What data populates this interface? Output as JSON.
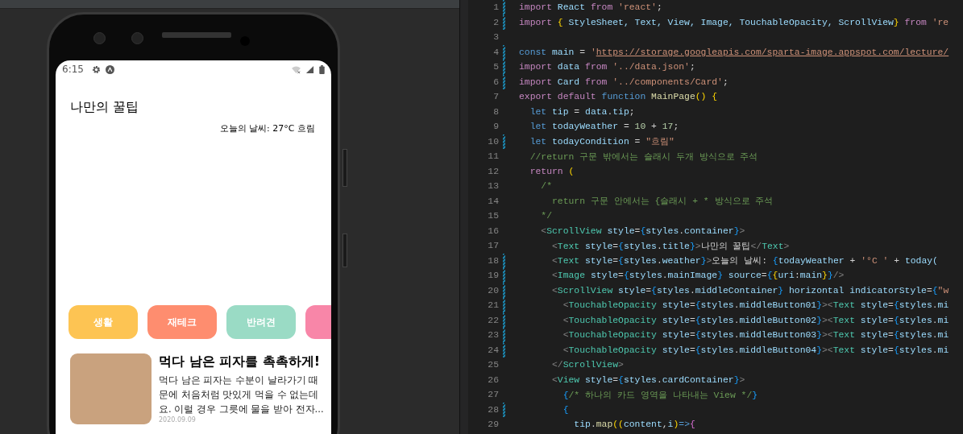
{
  "phone": {
    "status_bar": {
      "time": "6:15"
    },
    "app": {
      "title": "나만의 꿀팁",
      "weather": "오늘의 날씨: 27°C 흐림",
      "categories": [
        {
          "label": "생활",
          "color": "#fdc453"
        },
        {
          "label": "재테크",
          "color": "#fe8d6f"
        },
        {
          "label": "반려견",
          "color": "#9adbc5"
        },
        {
          "color": "#f886a8"
        }
      ],
      "cards": [
        {
          "title": "먹다 남은 피자를 촉촉하게!",
          "description": "먹다 남은 피자는 수분이 날라가기 때문에 처음처럼 맛있게 먹을 수 없는데요. 이럴 경우 그릇에 물을 받아 전자...",
          "date": "2020.09.09"
        }
      ]
    }
  },
  "editor": {
    "lines": [
      {
        "number": "1",
        "modified": true,
        "tokens": [
          {
            "kind": "kw",
            "text": "import"
          },
          {
            "kind": "var",
            "text": " React "
          },
          {
            "kind": "kw",
            "text": "from"
          },
          {
            "kind": "str",
            "text": " 'react'"
          },
          {
            "kind": "pl",
            "text": ";"
          }
        ]
      },
      {
        "number": "2",
        "modified": true,
        "tokens": [
          {
            "kind": "kw",
            "text": "import "
          },
          {
            "kind": "b1",
            "text": "{"
          },
          {
            "kind": "var",
            "text": " StyleSheet, Text, View, Image, TouchableOpacity, ScrollView"
          },
          {
            "kind": "b1",
            "text": "}"
          },
          {
            "kind": "kw",
            "text": " from "
          },
          {
            "kind": "str",
            "text": "'re"
          }
        ]
      },
      {
        "number": "3",
        "modified": false
      },
      {
        "number": "4",
        "modified": true,
        "tokens": [
          {
            "kind": "st",
            "text": "const "
          },
          {
            "kind": "var",
            "text": "main"
          },
          {
            "kind": "pl",
            "text": " = "
          },
          {
            "kind": "str",
            "text": "'"
          },
          {
            "kind": "link",
            "text": "https://storage.googleapis.com/sparta-image.appspot.com/lecture/"
          }
        ]
      },
      {
        "number": "5",
        "modified": true,
        "tokens": [
          {
            "kind": "kw",
            "text": "import "
          },
          {
            "kind": "var",
            "text": "data "
          },
          {
            "kind": "kw",
            "text": "from "
          },
          {
            "kind": "str",
            "text": "'../data.json'"
          },
          {
            "kind": "pl",
            "text": ";"
          }
        ]
      },
      {
        "number": "6",
        "modified": true,
        "tokens": [
          {
            "kind": "kw",
            "text": "import "
          },
          {
            "kind": "var",
            "text": "Card "
          },
          {
            "kind": "kw",
            "text": "from "
          },
          {
            "kind": "str",
            "text": "'../components/Card'"
          },
          {
            "kind": "pl",
            "text": ";"
          }
        ]
      },
      {
        "number": "7",
        "modified": false,
        "tokens": [
          {
            "kind": "kw",
            "text": "export default "
          },
          {
            "kind": "st",
            "text": "function "
          },
          {
            "kind": "fn",
            "text": "MainPage"
          },
          {
            "kind": "b1",
            "text": "()"
          },
          {
            "kind": "b1",
            "text": " {"
          }
        ]
      },
      {
        "number": "8",
        "modified": false,
        "tokens": [
          {
            "kind": "st",
            "text": "  let "
          },
          {
            "kind": "var",
            "text": "tip"
          },
          {
            "kind": "pl",
            "text": " = "
          },
          {
            "kind": "var",
            "text": "data"
          },
          {
            "kind": "pl",
            "text": "."
          },
          {
            "kind": "var",
            "text": "tip"
          },
          {
            "kind": "pl",
            "text": ";"
          }
        ]
      },
      {
        "number": "9",
        "modified": false,
        "tokens": [
          {
            "kind": "st",
            "text": "  let "
          },
          {
            "kind": "var",
            "text": "todayWeather"
          },
          {
            "kind": "pl",
            "text": " = "
          },
          {
            "kind": "num",
            "text": "10"
          },
          {
            "kind": "pl",
            "text": " + "
          },
          {
            "kind": "num",
            "text": "17"
          },
          {
            "kind": "pl",
            "text": ";"
          }
        ]
      },
      {
        "number": "10",
        "modified": true,
        "tokens": [
          {
            "kind": "st",
            "text": "  let "
          },
          {
            "kind": "var",
            "text": "todayCondition"
          },
          {
            "kind": "pl",
            "text": " = "
          },
          {
            "kind": "str",
            "text": "\"흐림\""
          }
        ]
      },
      {
        "number": "11",
        "modified": false,
        "tokens": [
          {
            "kind": "cm",
            "text": "  //return 구문 밖에서는 슬래시 두개 방식으로 주석"
          }
        ]
      },
      {
        "number": "12",
        "modified": false,
        "tokens": [
          {
            "kind": "kw",
            "text": "  return "
          },
          {
            "kind": "b1",
            "text": "("
          }
        ]
      },
      {
        "number": "13",
        "modified": false,
        "tokens": [
          {
            "kind": "cm",
            "text": "    /*"
          }
        ]
      },
      {
        "number": "14",
        "modified": false,
        "tokens": [
          {
            "kind": "cm",
            "text": "      return 구문 안에서는 {슬래시 + * 방식으로 주석"
          }
        ]
      },
      {
        "number": "15",
        "modified": false,
        "tokens": [
          {
            "kind": "cm",
            "text": "    */"
          }
        ]
      },
      {
        "number": "16",
        "modified": false,
        "tokens": [
          {
            "kind": "gray",
            "text": "    <"
          },
          {
            "kind": "tag",
            "text": "ScrollView"
          },
          {
            "kind": "var",
            "text": " style"
          },
          {
            "kind": "pl",
            "text": "="
          },
          {
            "kind": "b2",
            "text": "{"
          },
          {
            "kind": "var",
            "text": "styles"
          },
          {
            "kind": "pl",
            "text": "."
          },
          {
            "kind": "var",
            "text": "container"
          },
          {
            "kind": "b2",
            "text": "}"
          },
          {
            "kind": "gray",
            "text": ">"
          }
        ]
      },
      {
        "number": "17",
        "modified": false,
        "tokens": [
          {
            "kind": "gray",
            "text": "      <"
          },
          {
            "kind": "tag",
            "text": "Text"
          },
          {
            "kind": "var",
            "text": " style"
          },
          {
            "kind": "pl",
            "text": "="
          },
          {
            "kind": "b2",
            "text": "{"
          },
          {
            "kind": "var",
            "text": "styles"
          },
          {
            "kind": "pl",
            "text": "."
          },
          {
            "kind": "var",
            "text": "title"
          },
          {
            "kind": "b2",
            "text": "}"
          },
          {
            "kind": "gray",
            "text": ">"
          },
          {
            "kind": "pl",
            "text": "나만의 꿀팁"
          },
          {
            "kind": "gray",
            "text": "</"
          },
          {
            "kind": "tag",
            "text": "Text"
          },
          {
            "kind": "gray",
            "text": ">"
          }
        ]
      },
      {
        "number": "18",
        "modified": true,
        "tokens": [
          {
            "kind": "gray",
            "text": "      <"
          },
          {
            "kind": "tag",
            "text": "Text"
          },
          {
            "kind": "var",
            "text": " style"
          },
          {
            "kind": "pl",
            "text": "="
          },
          {
            "kind": "b2",
            "text": "{"
          },
          {
            "kind": "var",
            "text": "styles"
          },
          {
            "kind": "pl",
            "text": "."
          },
          {
            "kind": "var",
            "text": "weather"
          },
          {
            "kind": "b2",
            "text": "}"
          },
          {
            "kind": "gray",
            "text": ">"
          },
          {
            "kind": "pl",
            "text": "오늘의 날씨: "
          },
          {
            "kind": "b2",
            "text": "{"
          },
          {
            "kind": "var",
            "text": "todayWeather"
          },
          {
            "kind": "pl",
            "text": " + "
          },
          {
            "kind": "str",
            "text": "'°C '"
          },
          {
            "kind": "pl",
            "text": " + "
          },
          {
            "kind": "var",
            "text": "today("
          }
        ]
      },
      {
        "number": "19",
        "modified": true,
        "tokens": [
          {
            "kind": "gray",
            "text": "      <"
          },
          {
            "kind": "tag",
            "text": "Image"
          },
          {
            "kind": "var",
            "text": " style"
          },
          {
            "kind": "pl",
            "text": "="
          },
          {
            "kind": "b2",
            "text": "{"
          },
          {
            "kind": "var",
            "text": "styles"
          },
          {
            "kind": "pl",
            "text": "."
          },
          {
            "kind": "var",
            "text": "mainImage"
          },
          {
            "kind": "b2",
            "text": "}"
          },
          {
            "kind": "var",
            "text": " source"
          },
          {
            "kind": "pl",
            "text": "="
          },
          {
            "kind": "b2",
            "text": "{"
          },
          {
            "kind": "b1",
            "text": "{"
          },
          {
            "kind": "var",
            "text": "uri"
          },
          {
            "kind": "pl",
            "text": ":"
          },
          {
            "kind": "var",
            "text": "main"
          },
          {
            "kind": "b1",
            "text": "}"
          },
          {
            "kind": "b2",
            "text": "}"
          },
          {
            "kind": "gray",
            "text": "/>"
          }
        ]
      },
      {
        "number": "20",
        "modified": true,
        "tokens": [
          {
            "kind": "gray",
            "text": "      <"
          },
          {
            "kind": "tag",
            "text": "ScrollView"
          },
          {
            "kind": "var",
            "text": " style"
          },
          {
            "kind": "pl",
            "text": "="
          },
          {
            "kind": "b2",
            "text": "{"
          },
          {
            "kind": "var",
            "text": "styles"
          },
          {
            "kind": "pl",
            "text": "."
          },
          {
            "kind": "var",
            "text": "middleContainer"
          },
          {
            "kind": "b2",
            "text": "}"
          },
          {
            "kind": "var",
            "text": " horizontal indicatorStyle"
          },
          {
            "kind": "pl",
            "text": "="
          },
          {
            "kind": "b2",
            "text": "{"
          },
          {
            "kind": "str",
            "text": "\"w"
          }
        ]
      },
      {
        "number": "21",
        "modified": true,
        "tokens": [
          {
            "kind": "gray",
            "text": "        <"
          },
          {
            "kind": "tag",
            "text": "TouchableOpacity"
          },
          {
            "kind": "var",
            "text": " style"
          },
          {
            "kind": "pl",
            "text": "="
          },
          {
            "kind": "b2",
            "text": "{"
          },
          {
            "kind": "var",
            "text": "styles"
          },
          {
            "kind": "pl",
            "text": "."
          },
          {
            "kind": "var",
            "text": "middleButton01"
          },
          {
            "kind": "b2",
            "text": "}"
          },
          {
            "kind": "gray",
            "text": "><"
          },
          {
            "kind": "tag",
            "text": "Text"
          },
          {
            "kind": "var",
            "text": " style"
          },
          {
            "kind": "pl",
            "text": "="
          },
          {
            "kind": "b2",
            "text": "{"
          },
          {
            "kind": "var",
            "text": "styles"
          },
          {
            "kind": "pl",
            "text": "."
          },
          {
            "kind": "var",
            "text": "mi"
          }
        ]
      },
      {
        "number": "22",
        "modified": true,
        "tokens": [
          {
            "kind": "gray",
            "text": "        <"
          },
          {
            "kind": "tag",
            "text": "TouchableOpacity"
          },
          {
            "kind": "var",
            "text": " style"
          },
          {
            "kind": "pl",
            "text": "="
          },
          {
            "kind": "b2",
            "text": "{"
          },
          {
            "kind": "var",
            "text": "styles"
          },
          {
            "kind": "pl",
            "text": "."
          },
          {
            "kind": "var",
            "text": "middleButton02"
          },
          {
            "kind": "b2",
            "text": "}"
          },
          {
            "kind": "gray",
            "text": "><"
          },
          {
            "kind": "tag",
            "text": "Text"
          },
          {
            "kind": "var",
            "text": " style"
          },
          {
            "kind": "pl",
            "text": "="
          },
          {
            "kind": "b2",
            "text": "{"
          },
          {
            "kind": "var",
            "text": "styles"
          },
          {
            "kind": "pl",
            "text": "."
          },
          {
            "kind": "var",
            "text": "mi"
          }
        ]
      },
      {
        "number": "23",
        "modified": true,
        "tokens": [
          {
            "kind": "gray",
            "text": "        <"
          },
          {
            "kind": "tag",
            "text": "TouchableOpacity"
          },
          {
            "kind": "var",
            "text": " style"
          },
          {
            "kind": "pl",
            "text": "="
          },
          {
            "kind": "b2",
            "text": "{"
          },
          {
            "kind": "var",
            "text": "styles"
          },
          {
            "kind": "pl",
            "text": "."
          },
          {
            "kind": "var",
            "text": "middleButton03"
          },
          {
            "kind": "b2",
            "text": "}"
          },
          {
            "kind": "gray",
            "text": "><"
          },
          {
            "kind": "tag",
            "text": "Text"
          },
          {
            "kind": "var",
            "text": " style"
          },
          {
            "kind": "pl",
            "text": "="
          },
          {
            "kind": "b2",
            "text": "{"
          },
          {
            "kind": "var",
            "text": "styles"
          },
          {
            "kind": "pl",
            "text": "."
          },
          {
            "kind": "var",
            "text": "mi"
          }
        ]
      },
      {
        "number": "24",
        "modified": true,
        "tokens": [
          {
            "kind": "gray",
            "text": "        <"
          },
          {
            "kind": "tag",
            "text": "TouchableOpacity"
          },
          {
            "kind": "var",
            "text": " style"
          },
          {
            "kind": "pl",
            "text": "="
          },
          {
            "kind": "b2",
            "text": "{"
          },
          {
            "kind": "var",
            "text": "styles"
          },
          {
            "kind": "pl",
            "text": "."
          },
          {
            "kind": "var",
            "text": "middleButton04"
          },
          {
            "kind": "b2",
            "text": "}"
          },
          {
            "kind": "gray",
            "text": "><"
          },
          {
            "kind": "tag",
            "text": "Text"
          },
          {
            "kind": "var",
            "text": " style"
          },
          {
            "kind": "pl",
            "text": "="
          },
          {
            "kind": "b2",
            "text": "{"
          },
          {
            "kind": "var",
            "text": "styles"
          },
          {
            "kind": "pl",
            "text": "."
          },
          {
            "kind": "var",
            "text": "mi"
          }
        ]
      },
      {
        "number": "25",
        "modified": false,
        "tokens": [
          {
            "kind": "gray",
            "text": "      </"
          },
          {
            "kind": "tag",
            "text": "ScrollView"
          },
          {
            "kind": "gray",
            "text": ">"
          }
        ]
      },
      {
        "number": "26",
        "modified": false,
        "tokens": [
          {
            "kind": "gray",
            "text": "      <"
          },
          {
            "kind": "tag",
            "text": "View"
          },
          {
            "kind": "var",
            "text": " style"
          },
          {
            "kind": "pl",
            "text": "="
          },
          {
            "kind": "b2",
            "text": "{"
          },
          {
            "kind": "var",
            "text": "styles"
          },
          {
            "kind": "pl",
            "text": "."
          },
          {
            "kind": "var",
            "text": "cardContainer"
          },
          {
            "kind": "b2",
            "text": "}"
          },
          {
            "kind": "gray",
            "text": ">"
          }
        ]
      },
      {
        "number": "27",
        "modified": false,
        "tokens": [
          {
            "kind": "b2",
            "text": "        {"
          },
          {
            "kind": "cm",
            "text": "/* 하나의 카드 영역을 나타내는 View */"
          },
          {
            "kind": "b2",
            "text": "}"
          }
        ]
      },
      {
        "number": "28",
        "modified": true,
        "tokens": [
          {
            "kind": "b2",
            "text": "        {"
          }
        ]
      },
      {
        "number": "29",
        "modified": false,
        "tokens": [
          {
            "kind": "var",
            "text": "          tip"
          },
          {
            "kind": "pl",
            "text": "."
          },
          {
            "kind": "fn",
            "text": "map"
          },
          {
            "kind": "b1",
            "text": "(("
          },
          {
            "kind": "var",
            "text": "content"
          },
          {
            "kind": "pl",
            "text": ","
          },
          {
            "kind": "var",
            "text": "i"
          },
          {
            "kind": "b1",
            "text": ")"
          },
          {
            "kind": "st",
            "text": "=>"
          },
          {
            "kind": "b3",
            "text": "{"
          }
        ]
      }
    ]
  }
}
